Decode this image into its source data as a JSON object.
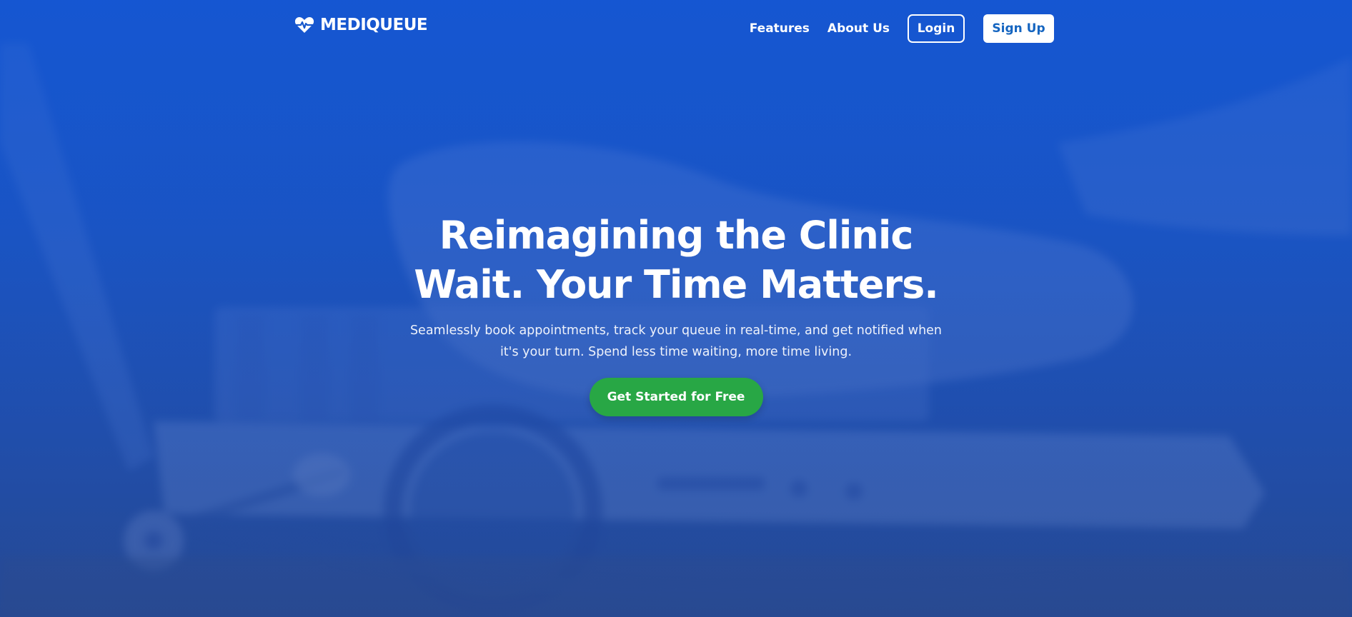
{
  "brand": {
    "name": "MEDIQUEUE",
    "icon": "heart-pulse-icon"
  },
  "nav": {
    "links": [
      {
        "label": "Features"
      },
      {
        "label": "About Us"
      }
    ],
    "login_label": "Login",
    "signup_label": "Sign Up"
  },
  "hero": {
    "headline_line1": "Reimagining the Clinic",
    "headline_line2": "Wait. Your Time Matters.",
    "subtext_line1": "Seamlessly book appointments, track your queue in real-time, and get notified when",
    "subtext_line2": "it's your turn. Spend less time waiting, more time living.",
    "cta_label": "Get Started for Free"
  },
  "colors": {
    "primary_blue": "#1657cc",
    "cta_green": "#28a745",
    "signup_text": "#1565c0",
    "white": "#ffffff"
  }
}
